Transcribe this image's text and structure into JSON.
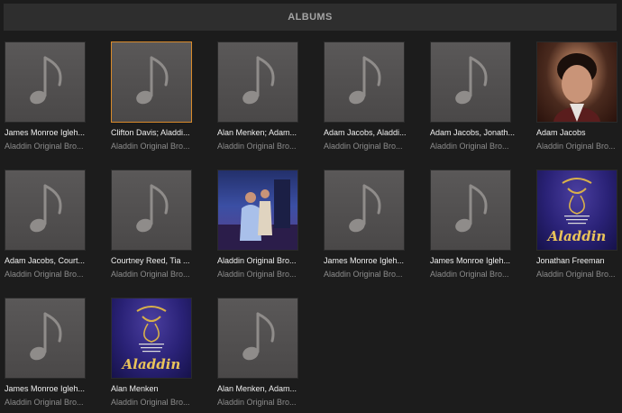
{
  "header": {
    "title": "ALBUMS"
  },
  "albums": [
    {
      "artist": "James Monroe Igleh...",
      "album": "Aladdin Original Bro...",
      "art": "placeholder"
    },
    {
      "artist": "Clifton Davis; Aladdi...",
      "album": "Aladdin Original Bro...",
      "art": "placeholder",
      "selected": true
    },
    {
      "artist": "Alan Menken; Adam...",
      "album": "Aladdin Original Bro...",
      "art": "placeholder"
    },
    {
      "artist": "Adam Jacobs, Aladdi...",
      "album": "Aladdin Original Bro...",
      "art": "placeholder"
    },
    {
      "artist": "Adam Jacobs, Jonath...",
      "album": "Aladdin Original Bro...",
      "art": "placeholder"
    },
    {
      "artist": "Adam Jacobs",
      "album": "Aladdin Original Bro...",
      "art": "portrait"
    },
    {
      "artist": "Adam Jacobs, Court...",
      "album": "Aladdin Original Bro...",
      "art": "placeholder"
    },
    {
      "artist": "Courtney Reed, Tia ...",
      "album": "Aladdin Original Bro...",
      "art": "placeholder"
    },
    {
      "artist": "Aladdin Original Bro...",
      "album": "Aladdin Original Bro...",
      "art": "stage"
    },
    {
      "artist": "James Monroe Igleh...",
      "album": "Aladdin Original Bro...",
      "art": "placeholder"
    },
    {
      "artist": "James Monroe Igleh...",
      "album": "Aladdin Original Bro...",
      "art": "placeholder"
    },
    {
      "artist": "Jonathan Freeman",
      "album": "Aladdin Original Bro...",
      "art": "poster"
    },
    {
      "artist": "James Monroe Igleh...",
      "album": "Aladdin Original Bro...",
      "art": "placeholder"
    },
    {
      "artist": "Alan Menken",
      "album": "Aladdin Original Bro...",
      "art": "poster"
    },
    {
      "artist": "Alan Menken, Adam...",
      "album": "Aladdin Original Bro...",
      "art": "placeholder"
    }
  ],
  "poster_text": {
    "title": "Aladdin"
  },
  "colors": {
    "background": "#1c1c1c",
    "header": "#2e2e2e",
    "selected_border": "#d98b2b"
  },
  "icons": {
    "placeholder": "music-note-icon"
  }
}
